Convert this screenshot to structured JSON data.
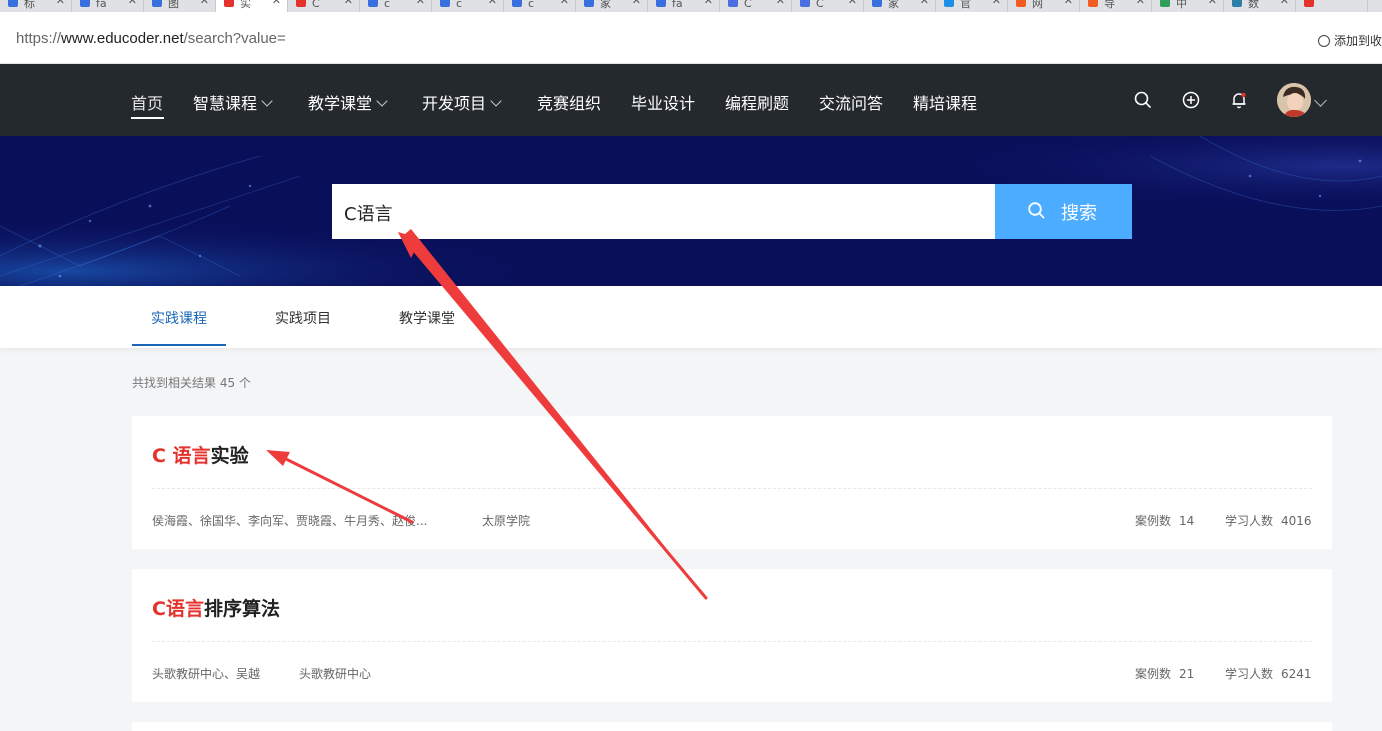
{
  "browser": {
    "tabs": [
      {
        "label": "标",
        "color": "#3a6fe0"
      },
      {
        "label": "fa",
        "color": "#3a6fe0"
      },
      {
        "label": "图",
        "color": "#3a6fe0"
      },
      {
        "label": "实",
        "color": "#e4322d",
        "active": true
      },
      {
        "label": "C",
        "color": "#e4322d"
      },
      {
        "label": "c",
        "color": "#3a6fe0"
      },
      {
        "label": "c",
        "color": "#3a6fe0"
      },
      {
        "label": "c",
        "color": "#3a6fe0"
      },
      {
        "label": "家",
        "color": "#3a6fe0"
      },
      {
        "label": "fa",
        "color": "#3a6fe0"
      },
      {
        "label": "C",
        "color": "#4a6ee0"
      },
      {
        "label": "C",
        "color": "#4a6ee0"
      },
      {
        "label": "家",
        "color": "#3a6fe0"
      },
      {
        "label": "官",
        "color": "#1d8fe8"
      },
      {
        "label": "网",
        "color": "#f25c23"
      },
      {
        "label": "导",
        "color": "#f25c23"
      },
      {
        "label": "中",
        "color": "#2e9e5b"
      },
      {
        "label": "数",
        "color": "#2e7fa8"
      },
      {
        "label": "",
        "color": "#e4322d"
      }
    ],
    "url_prefix": "https://",
    "url_host": "www.educoder.net",
    "url_path": "/search?value=",
    "add_favorite": "添加到收"
  },
  "nav": {
    "items": [
      {
        "label": "首页"
      },
      {
        "label": "智慧课程"
      },
      {
        "label": "教学课堂"
      },
      {
        "label": "开发项目"
      },
      {
        "label": "竞赛组织"
      },
      {
        "label": "毕业设计"
      },
      {
        "label": "编程刷题"
      },
      {
        "label": "交流问答"
      },
      {
        "label": "精培课程"
      }
    ]
  },
  "search": {
    "value": "C语言",
    "button_label": "搜索"
  },
  "result_tabs": [
    {
      "label": "实践课程"
    },
    {
      "label": "实践项目"
    },
    {
      "label": "教学课堂"
    }
  ],
  "result_count": "共找到相关结果 45 个",
  "results": [
    {
      "title_highlight": "C 语言",
      "title_rest": "实验",
      "authors": "侯海霞、徐国华、李向军、贾晓霞、牛月秀、赵俊...",
      "school": "太原学院",
      "cases_label": "案例数",
      "cases": "14",
      "learners_label": "学习人数",
      "learners": "4016"
    },
    {
      "title_highlight": "C语言",
      "title_rest": "排序算法",
      "authors": "头歌教研中心、吴越",
      "school": "头歌教研中心",
      "cases_label": "案例数",
      "cases": "21",
      "learners_label": "学习人数",
      "learners": "6241"
    }
  ],
  "colors": {
    "nav_bg": "#24292e",
    "banner_bg": "#0a0f5a",
    "accent": "#4cacff",
    "highlight": "#e4322d",
    "tab_active": "#1a66b8",
    "annotation_arrow": "#ee3b3b"
  }
}
